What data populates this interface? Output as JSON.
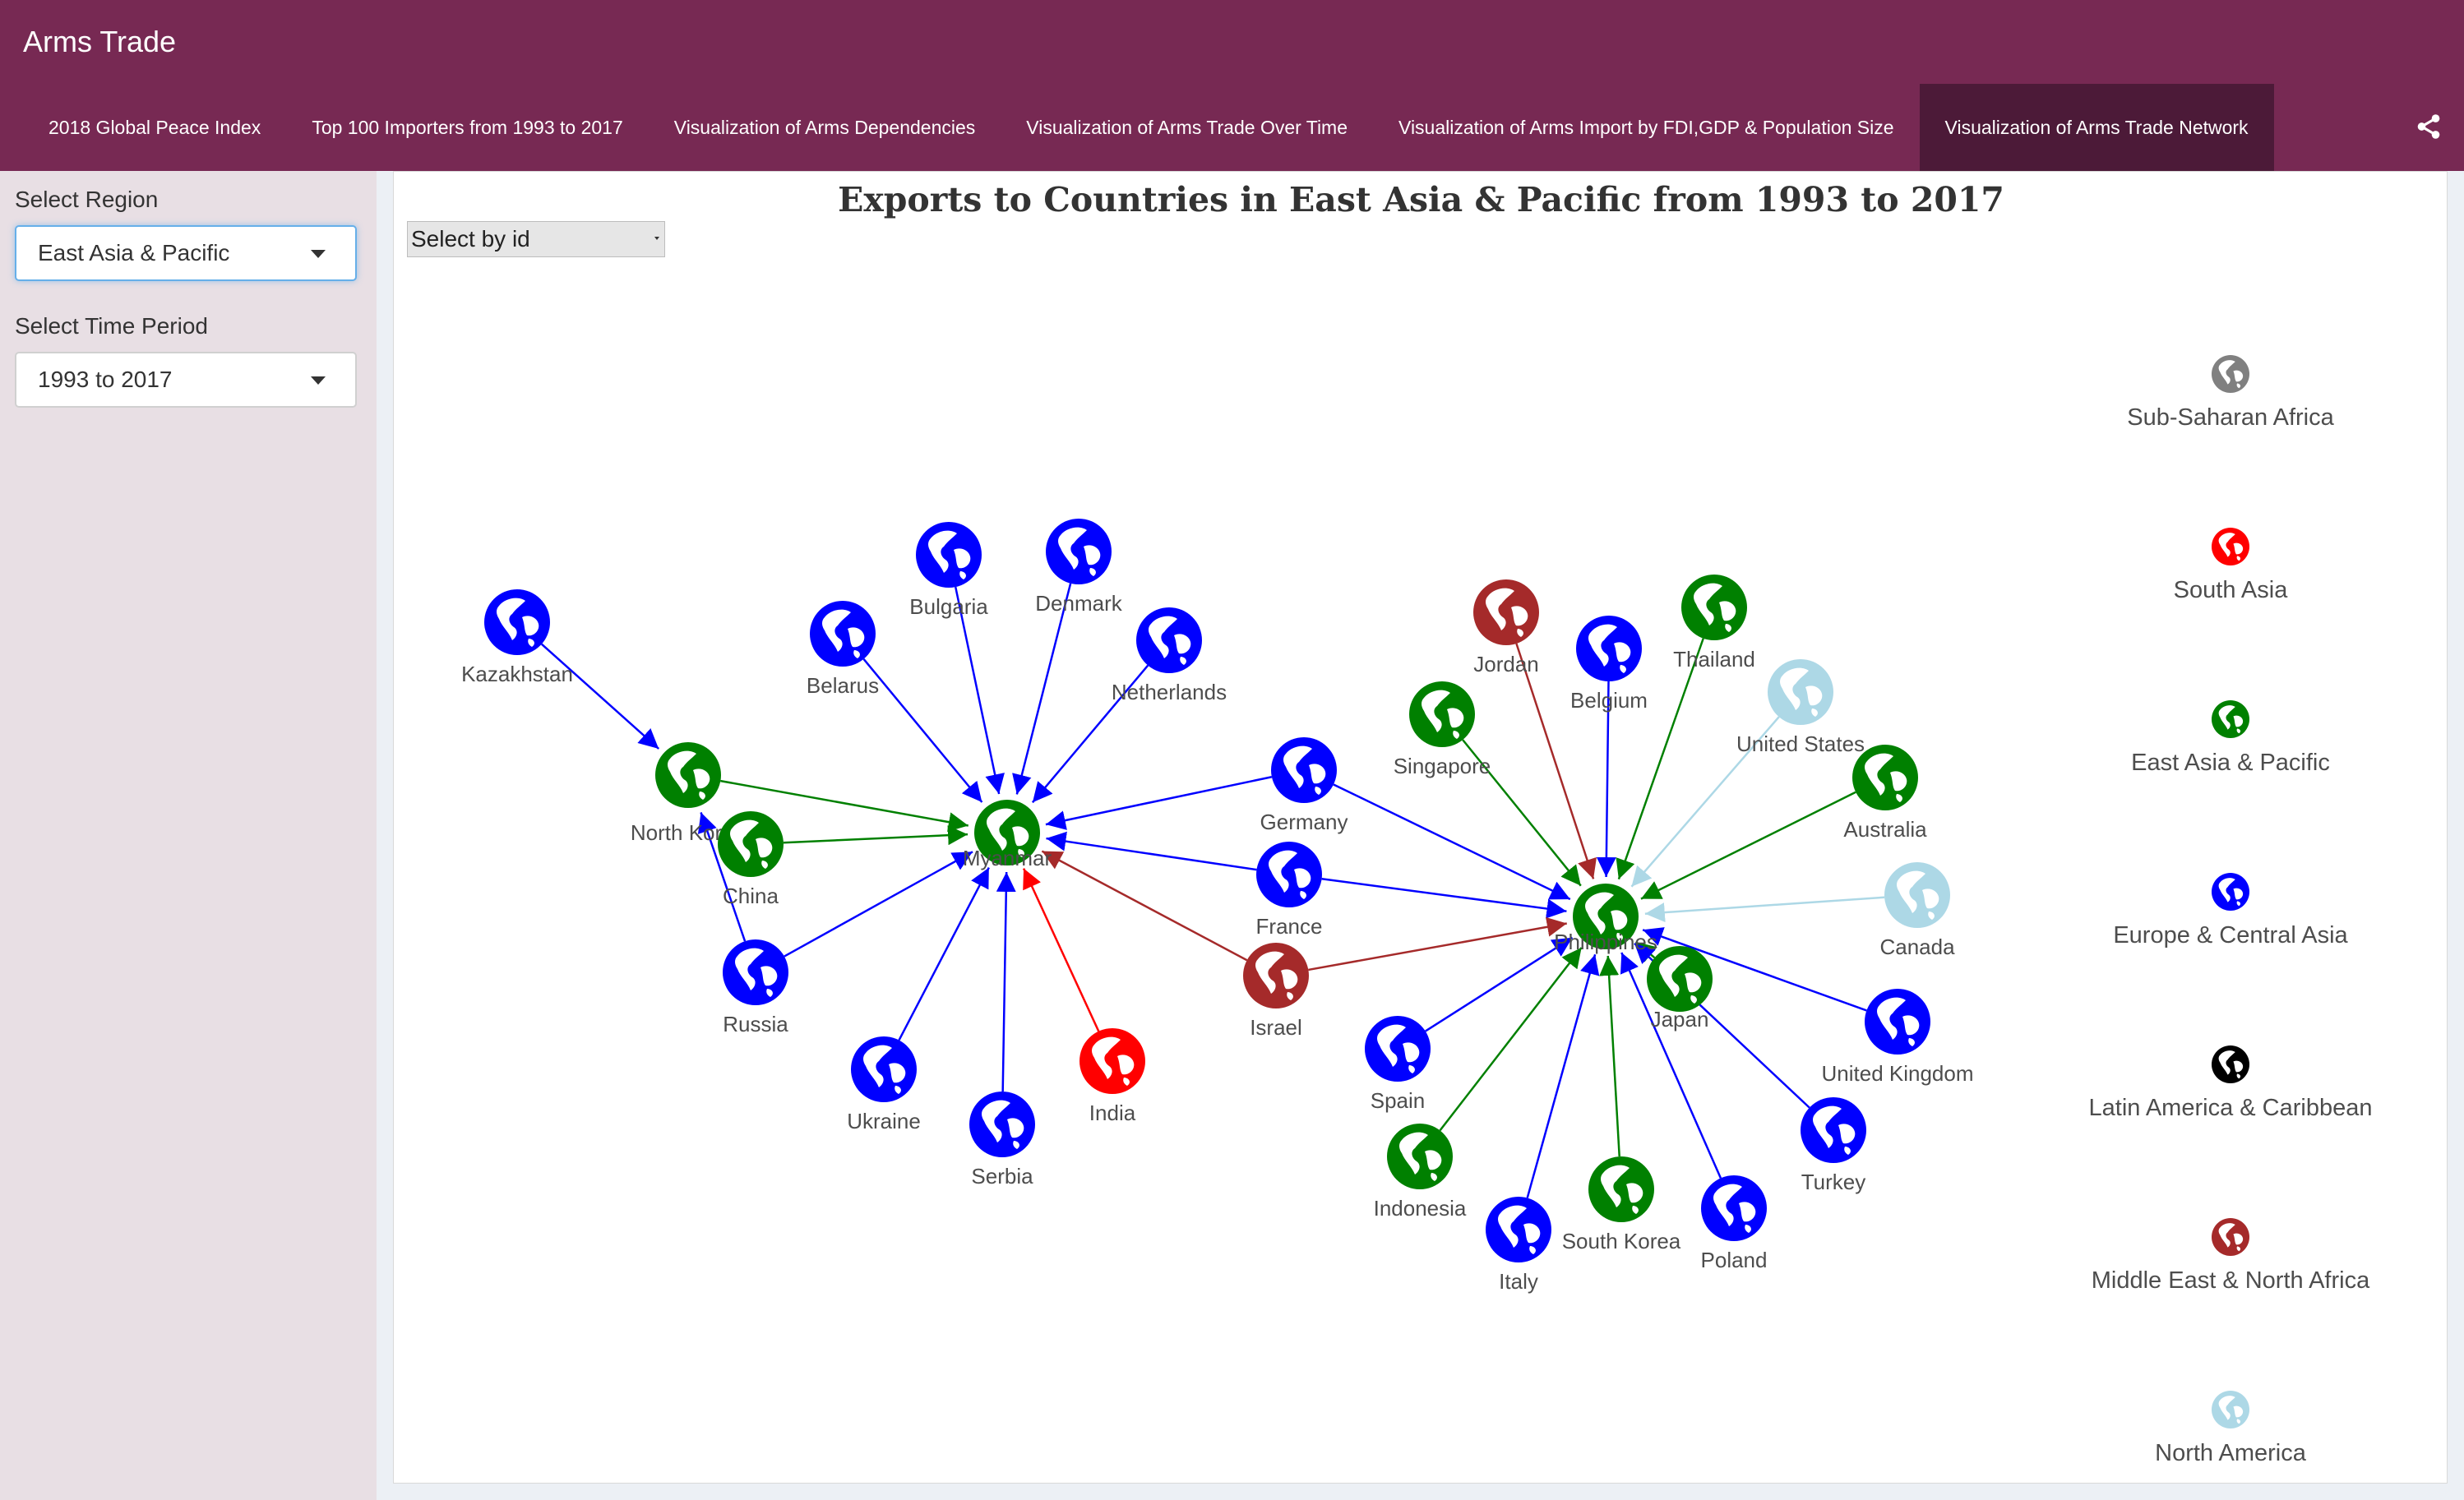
{
  "app": {
    "title": "Arms Trade"
  },
  "nav": {
    "tabs": [
      {
        "label": "2018 Global Peace Index",
        "active": false
      },
      {
        "label": "Top 100 Importers from 1993 to 2017",
        "active": false
      },
      {
        "label": "Visualization of Arms Dependencies",
        "active": false
      },
      {
        "label": "Visualization of Arms Trade Over Time",
        "active": false
      },
      {
        "label": "Visualization of Arms Import by FDI,GDP & Population Size",
        "active": false
      },
      {
        "label": "Visualization of Arms Trade Network",
        "active": true
      }
    ],
    "share_icon": "share-icon"
  },
  "sidebar": {
    "region_label": "Select Region",
    "region_value": "East Asia & Pacific",
    "period_label": "Select Time Period",
    "period_value": "1993 to 2017"
  },
  "network": {
    "title": "Exports to Countries in East Asia & Pacific from 1993 to 2017",
    "select_by_id": "Select by id",
    "groups": [
      {
        "name": "Sub-Saharan Africa",
        "color": "#808080"
      },
      {
        "name": "South Asia",
        "color": "#ff0000"
      },
      {
        "name": "East Asia & Pacific",
        "color": "#008000"
      },
      {
        "name": "Europe & Central Asia",
        "color": "#0000ff"
      },
      {
        "name": "Latin America & Caribbean",
        "color": "#000000"
      },
      {
        "name": "Middle East & North Africa",
        "color": "#a52a2a"
      },
      {
        "name": "North America",
        "color": "#add8e6"
      }
    ],
    "nodes": [
      {
        "id": "Kazakhstan",
        "group": "Europe & Central Asia"
      },
      {
        "id": "Bulgaria",
        "group": "Europe & Central Asia"
      },
      {
        "id": "Denmark",
        "group": "Europe & Central Asia"
      },
      {
        "id": "Belarus",
        "group": "Europe & Central Asia"
      },
      {
        "id": "Netherlands",
        "group": "Europe & Central Asia"
      },
      {
        "id": "North Korea",
        "group": "East Asia & Pacific"
      },
      {
        "id": "China",
        "group": "East Asia & Pacific"
      },
      {
        "id": "Myanmar",
        "group": "East Asia & Pacific"
      },
      {
        "id": "Germany",
        "group": "Europe & Central Asia"
      },
      {
        "id": "France",
        "group": "Europe & Central Asia"
      },
      {
        "id": "Russia",
        "group": "Europe & Central Asia"
      },
      {
        "id": "Israel",
        "group": "Middle East & North Africa"
      },
      {
        "id": "Ukraine",
        "group": "Europe & Central Asia"
      },
      {
        "id": "Serbia",
        "group": "Europe & Central Asia"
      },
      {
        "id": "India",
        "group": "South Asia"
      },
      {
        "id": "Jordan",
        "group": "Middle East & North Africa"
      },
      {
        "id": "Belgium",
        "group": "Europe & Central Asia"
      },
      {
        "id": "Thailand",
        "group": "East Asia & Pacific"
      },
      {
        "id": "Singapore",
        "group": "East Asia & Pacific"
      },
      {
        "id": "United States",
        "group": "North America"
      },
      {
        "id": "Australia",
        "group": "East Asia & Pacific"
      },
      {
        "id": "Canada",
        "group": "North America"
      },
      {
        "id": "Philippines",
        "group": "East Asia & Pacific"
      },
      {
        "id": "Japan",
        "group": "East Asia & Pacific"
      },
      {
        "id": "Spain",
        "group": "Europe & Central Asia"
      },
      {
        "id": "United Kingdom",
        "group": "Europe & Central Asia"
      },
      {
        "id": "Indonesia",
        "group": "East Asia & Pacific"
      },
      {
        "id": "Turkey",
        "group": "Europe & Central Asia"
      },
      {
        "id": "South Korea",
        "group": "East Asia & Pacific"
      },
      {
        "id": "Poland",
        "group": "Europe & Central Asia"
      },
      {
        "id": "Italy",
        "group": "Europe & Central Asia"
      }
    ],
    "edges": [
      [
        "Kazakhstan",
        "North Korea"
      ],
      [
        "North Korea",
        "Myanmar"
      ],
      [
        "China",
        "Myanmar"
      ],
      [
        "Russia",
        "North Korea"
      ],
      [
        "Russia",
        "Myanmar"
      ],
      [
        "Belarus",
        "Myanmar"
      ],
      [
        "Bulgaria",
        "Myanmar"
      ],
      [
        "Denmark",
        "Myanmar"
      ],
      [
        "Netherlands",
        "Myanmar"
      ],
      [
        "Germany",
        "Myanmar"
      ],
      [
        "France",
        "Myanmar"
      ],
      [
        "Israel",
        "Myanmar"
      ],
      [
        "Ukraine",
        "Myanmar"
      ],
      [
        "Serbia",
        "Myanmar"
      ],
      [
        "India",
        "Myanmar"
      ],
      [
        "Jordan",
        "Philippines"
      ],
      [
        "Belgium",
        "Philippines"
      ],
      [
        "Thailand",
        "Philippines"
      ],
      [
        "Singapore",
        "Philippines"
      ],
      [
        "United States",
        "Philippines"
      ],
      [
        "Australia",
        "Philippines"
      ],
      [
        "Canada",
        "Philippines"
      ],
      [
        "Germany",
        "Philippines"
      ],
      [
        "France",
        "Philippines"
      ],
      [
        "Israel",
        "Philippines"
      ],
      [
        "Japan",
        "Philippines"
      ],
      [
        "Spain",
        "Philippines"
      ],
      [
        "United Kingdom",
        "Philippines"
      ],
      [
        "Indonesia",
        "Philippines"
      ],
      [
        "Turkey",
        "Philippines"
      ],
      [
        "South Korea",
        "Philippines"
      ],
      [
        "Poland",
        "Philippines"
      ],
      [
        "Italy",
        "Philippines"
      ]
    ]
  }
}
